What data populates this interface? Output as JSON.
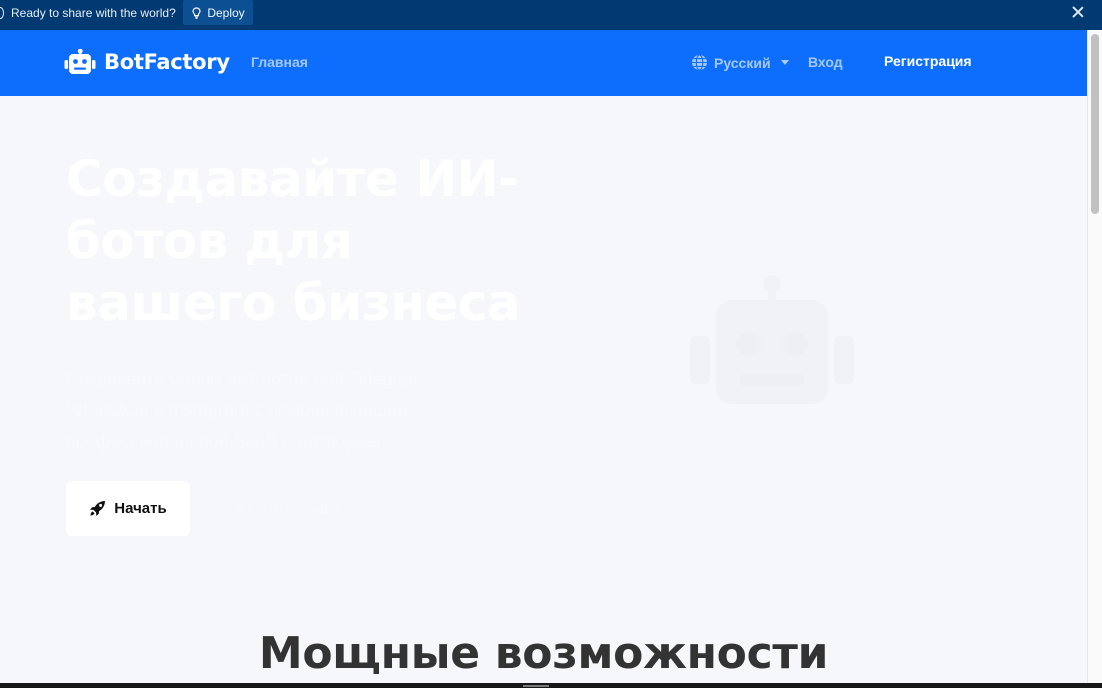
{
  "deploy_bar": {
    "message": "Ready to share with the world?",
    "deploy_label": "Deploy"
  },
  "navbar": {
    "brand": "BotFactory",
    "home": "Главная",
    "language": "Русский",
    "login": "Вход",
    "register": "Регистрация"
  },
  "hero": {
    "title": "Создавайте ИИ-ботов для вашего бизнеса",
    "subtitle": "Создавайте умных чат-ботов для Telegram, WhatsApp и Instagram с помощью нашей профессиональной SaaS платформы",
    "start_button": "Начать",
    "more_button": "Узнать больше"
  },
  "features": {
    "title": "Мощные возможности"
  },
  "colors": {
    "navbar": "#0d6efd",
    "deploy_bar": "#013a73",
    "page_bg": "#f6f7fb",
    "heading_dark": "#333333"
  },
  "icons": {
    "deploy": "bulb-icon",
    "brand": "robot-icon",
    "language": "globe-icon",
    "start": "rocket-icon",
    "hero_art": "robot-icon",
    "close": "close-icon"
  }
}
